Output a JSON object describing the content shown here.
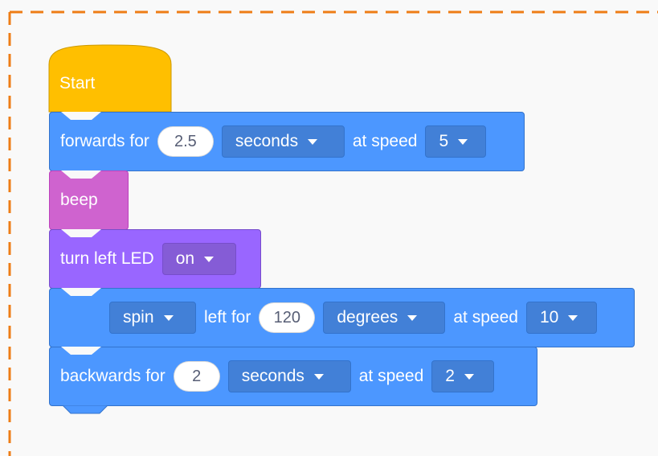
{
  "colors": {
    "motion": "#4c97ff",
    "sound": "#cf63cf",
    "looks": "#9966ff",
    "event": "#ffbf00",
    "workspace_border": "#ee7d16"
  },
  "blocks": {
    "start": {
      "label": "Start"
    },
    "forwards": {
      "label": "forwards for",
      "duration": "2.5",
      "unit": "seconds",
      "speed_label": "at speed",
      "speed": "5"
    },
    "beep": {
      "label": "beep"
    },
    "led": {
      "label": "turn left LED",
      "state": "on"
    },
    "spin": {
      "mode": "spin",
      "label": "left for",
      "amount": "120",
      "unit": "degrees",
      "speed_label": "at speed",
      "speed": "10"
    },
    "backwards": {
      "label": "backwards for",
      "duration": "2",
      "unit": "seconds",
      "speed_label": "at speed",
      "speed": "2"
    }
  }
}
